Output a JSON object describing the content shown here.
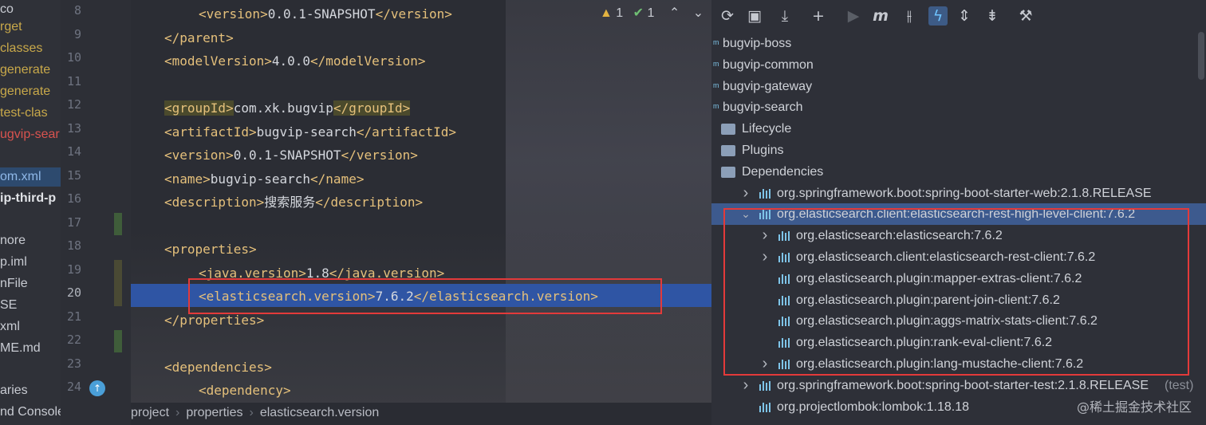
{
  "project_tree": {
    "items": [
      {
        "label": "co",
        "color": "#c8cbd2"
      },
      {
        "label": "rget",
        "color": "#c9a94a"
      },
      {
        "label": "classes",
        "color": "#c9a94a"
      },
      {
        "label": "generate",
        "color": "#c9a94a"
      },
      {
        "label": "generate",
        "color": "#c9a94a"
      },
      {
        "label": "test-clas",
        "color": "#c9a94a"
      },
      {
        "label": "ugvip-sear",
        "color": "#d9534f"
      },
      {
        "label": "om.xml",
        "color": "#8fb8e8",
        "selected": true
      },
      {
        "label": "ip-third-p",
        "color": "#e0e2e6",
        "bold": true
      },
      {
        "label": "nore",
        "color": "#c8cbd2"
      },
      {
        "label": "p.iml",
        "color": "#c8cbd2"
      },
      {
        "label": "nFile",
        "color": "#c8cbd2"
      },
      {
        "label": "SE",
        "color": "#c8cbd2"
      },
      {
        "label": "xml",
        "color": "#c8cbd2"
      },
      {
        "label": "ME.md",
        "color": "#c8cbd2"
      },
      {
        "label": "aries",
        "color": "#c8cbd2"
      },
      {
        "label": "nd Console",
        "color": "#c8cbd2"
      }
    ]
  },
  "editor": {
    "line_numbers": [
      "8",
      "9",
      "10",
      "11",
      "12",
      "13",
      "14",
      "15",
      "16",
      "17",
      "18",
      "19",
      "20",
      "21",
      "22",
      "23",
      "24"
    ],
    "lines": [
      {
        "indent": "    ",
        "open": "<version>",
        "text": "0.0.1-SNAPSHOT",
        "close": "</version>"
      },
      {
        "indent": "",
        "open": "</parent>",
        "text": "",
        "close": ""
      },
      {
        "indent": "",
        "open": "<modelVersion>",
        "text": "4.0.0",
        "close": "</modelVersion>"
      },
      {
        "indent": "",
        "open": "",
        "text": "",
        "close": ""
      },
      {
        "indent": "",
        "open": "<groupId>",
        "text": "com.xk.bugvip",
        "close": "</groupId>",
        "highlight": true
      },
      {
        "indent": "",
        "open": "<artifactId>",
        "text": "bugvip-search",
        "close": "</artifactId>"
      },
      {
        "indent": "",
        "open": "<version>",
        "text": "0.0.1-SNAPSHOT",
        "close": "</version>"
      },
      {
        "indent": "",
        "open": "<name>",
        "text": "bugvip-search",
        "close": "</name>"
      },
      {
        "indent": "",
        "open": "<description>",
        "text": "搜索服务",
        "close": "</description>"
      },
      {
        "indent": "",
        "open": "",
        "text": "",
        "close": ""
      },
      {
        "indent": "",
        "open": "<properties>",
        "text": "",
        "close": ""
      },
      {
        "indent": "    ",
        "open": "<java.version>",
        "text": "1.8",
        "close": "</java.version>"
      },
      {
        "indent": "    ",
        "open": "<elasticsearch.version>",
        "text": "7.6.2",
        "close": "</elasticsearch.version>",
        "current": true
      },
      {
        "indent": "",
        "open": "</properties>",
        "text": "",
        "close": ""
      },
      {
        "indent": "",
        "open": "",
        "text": "",
        "close": ""
      },
      {
        "indent": "",
        "open": "<dependencies>",
        "text": "",
        "close": ""
      },
      {
        "indent": "    ",
        "open": "<dependency>",
        "text": "",
        "close": ""
      }
    ],
    "inspections": {
      "warnings": "1",
      "ok": "1"
    }
  },
  "breadcrumb": {
    "items": [
      "project",
      "properties",
      "elasticsearch.version"
    ]
  },
  "maven": {
    "toolbar_icons": [
      "reload-icon",
      "add-folder-icon",
      "download-icon",
      "plus-icon",
      "run-icon",
      "maven-icon",
      "skip-tests-icon",
      "offline-icon",
      "expand-icon",
      "collapse-icon",
      "settings-wrench-icon"
    ],
    "rows": [
      {
        "level": 0,
        "type": "module",
        "label": "bugvip-boss"
      },
      {
        "level": 0,
        "type": "module",
        "label": "bugvip-common"
      },
      {
        "level": 0,
        "type": "module",
        "label": "bugvip-gateway"
      },
      {
        "level": 0,
        "type": "module",
        "label": "bugvip-search"
      },
      {
        "level": 1,
        "type": "folder",
        "label": "Lifecycle"
      },
      {
        "level": 1,
        "type": "folder",
        "label": "Plugins"
      },
      {
        "level": 1,
        "type": "folder",
        "label": "Dependencies"
      },
      {
        "level": 2,
        "type": "dep",
        "chevron": "right",
        "label": "org.springframework.boot:spring-boot-starter-web:2.1.8.RELEASE"
      },
      {
        "level": 2,
        "type": "dep",
        "chevron": "down",
        "label": "org.elasticsearch.client:elasticsearch-rest-high-level-client:7.6.2",
        "selected": true
      },
      {
        "level": 3,
        "type": "dep",
        "chevron": "right",
        "label": "org.elasticsearch:elasticsearch:7.6.2"
      },
      {
        "level": 3,
        "type": "dep",
        "chevron": "right",
        "label": "org.elasticsearch.client:elasticsearch-rest-client:7.6.2"
      },
      {
        "level": 3,
        "type": "dep",
        "chevron": "",
        "label": "org.elasticsearch.plugin:mapper-extras-client:7.6.2"
      },
      {
        "level": 3,
        "type": "dep",
        "chevron": "",
        "label": "org.elasticsearch.plugin:parent-join-client:7.6.2"
      },
      {
        "level": 3,
        "type": "dep",
        "chevron": "",
        "label": "org.elasticsearch.plugin:aggs-matrix-stats-client:7.6.2"
      },
      {
        "level": 3,
        "type": "dep",
        "chevron": "",
        "label": "org.elasticsearch.plugin:rank-eval-client:7.6.2"
      },
      {
        "level": 3,
        "type": "dep",
        "chevron": "right",
        "label": "org.elasticsearch.plugin:lang-mustache-client:7.6.2"
      },
      {
        "level": 2,
        "type": "dep",
        "chevron": "right",
        "label": "org.springframework.boot:spring-boot-starter-test:2.1.8.RELEASE",
        "suffix": "(test)"
      },
      {
        "level": 2,
        "type": "dep",
        "chevron": "",
        "label": "org.projectlombok:lombok:1.18.18"
      }
    ],
    "watermark": "@稀土掘金技术社区"
  },
  "colors": {
    "tag": "#e5c07b",
    "selection": "#2f55a4",
    "red_box": "#e33a3a",
    "maven_selection": "#3d5a8e"
  }
}
